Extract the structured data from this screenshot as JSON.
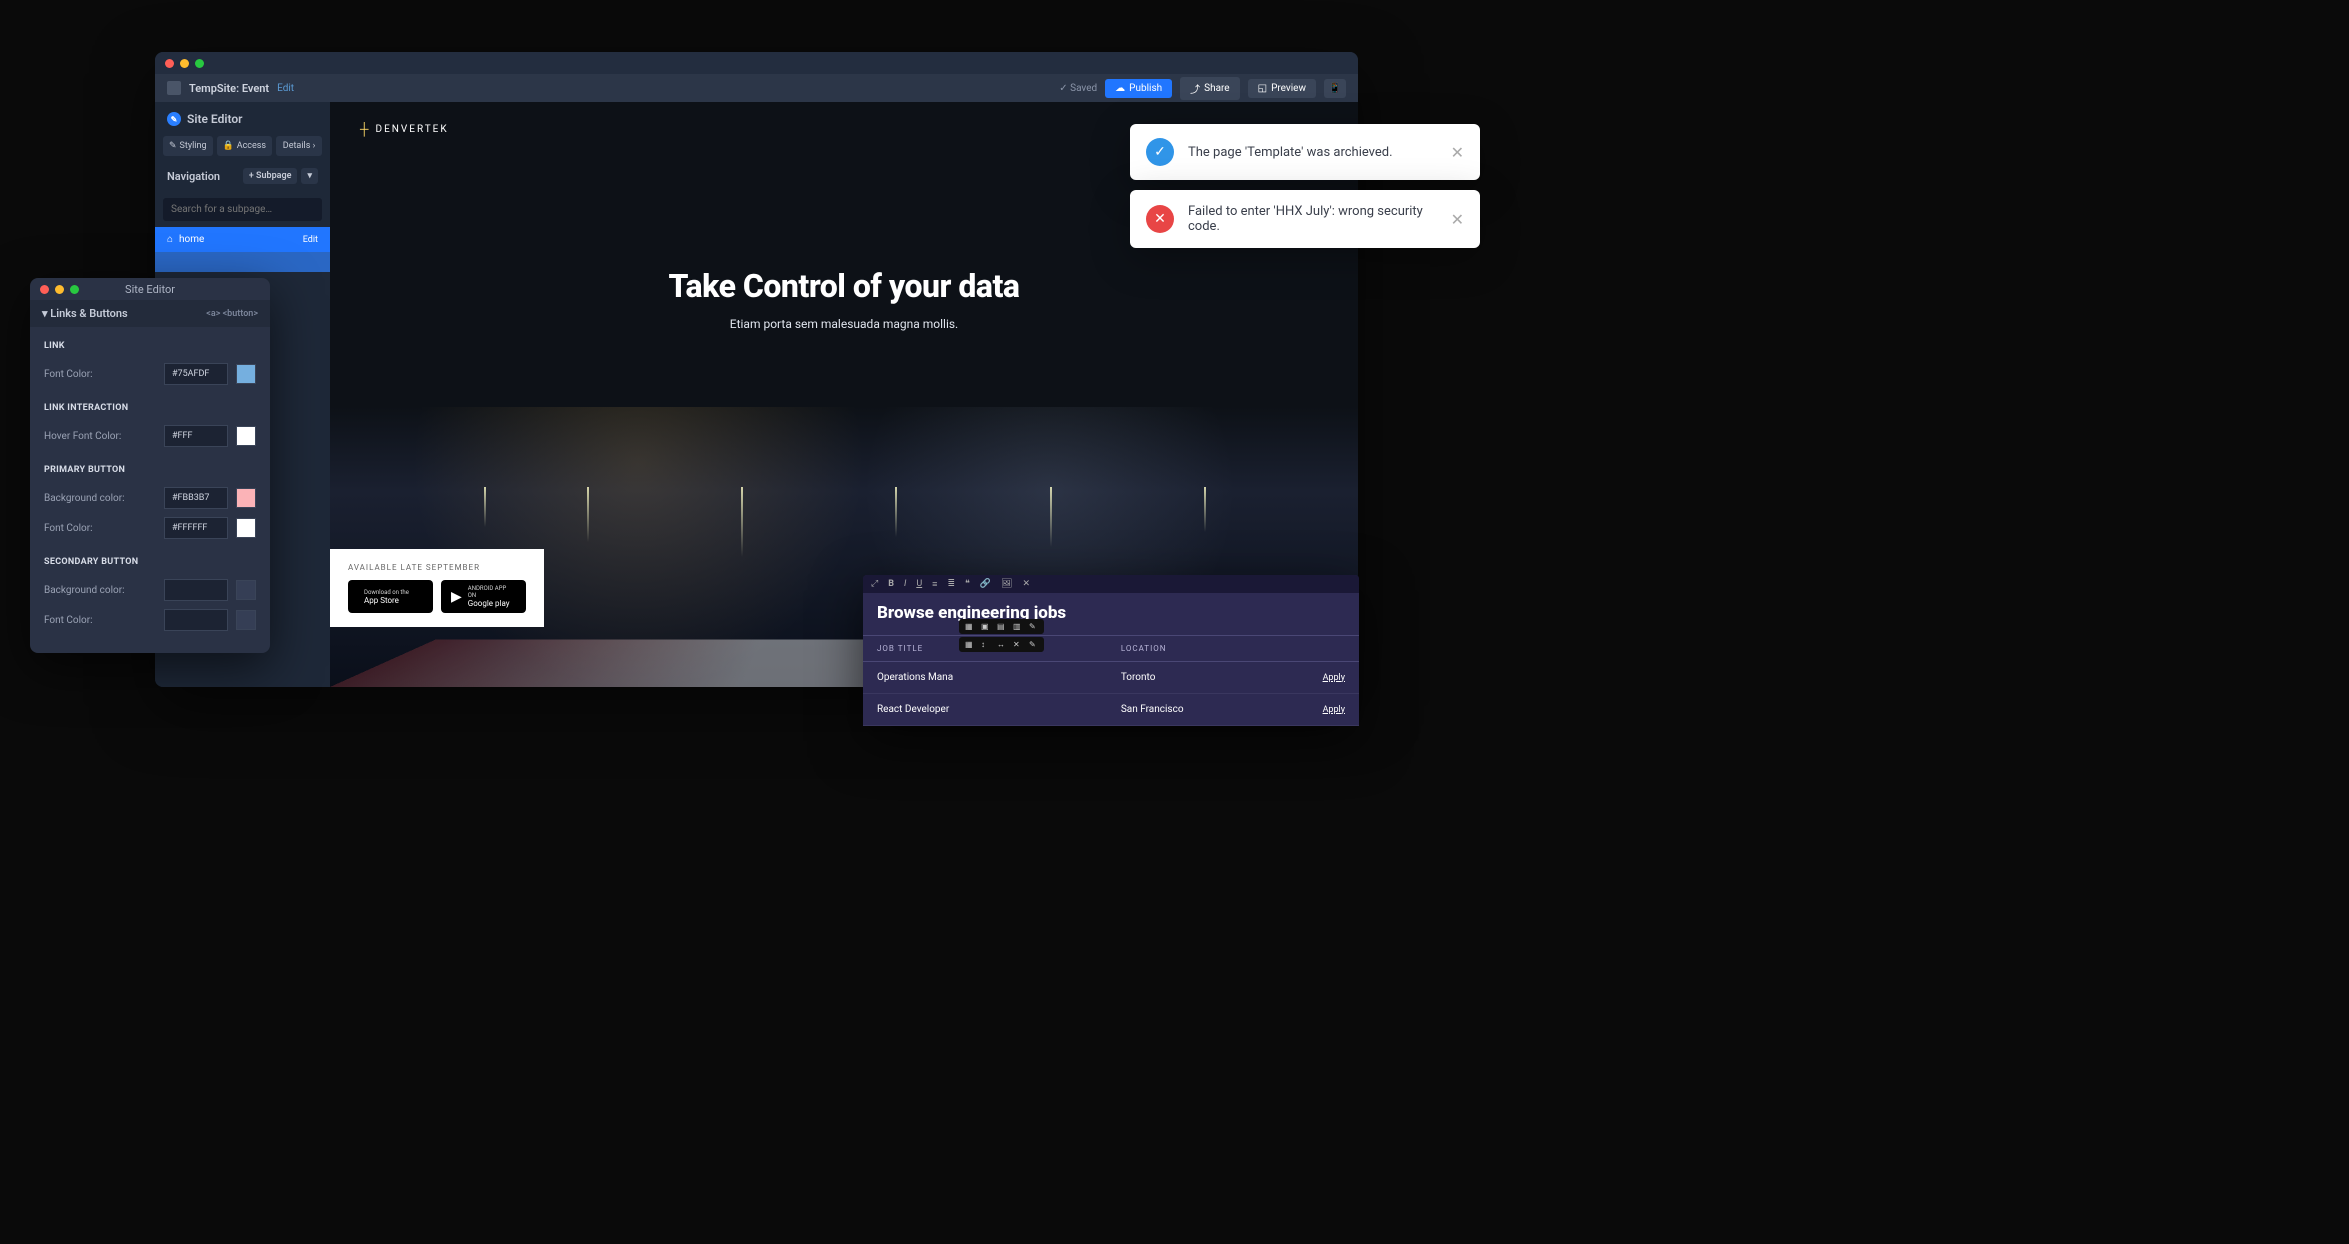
{
  "mainWindow": {
    "siteName": "TempSite: Event",
    "editLink": "Edit",
    "saved": "Saved",
    "publishBtn": "Publish",
    "shareBtn": "Share",
    "previewBtn": "Preview"
  },
  "sidebar": {
    "title": "Site Editor",
    "tabs": {
      "styling": "Styling",
      "access": "Access",
      "details": "Details ›"
    },
    "navigation": {
      "title": "Navigation",
      "addBtn": "+ Subpage",
      "searchPlaceholder": "Search for a subpage…",
      "page": {
        "name": "home",
        "editLabel": "Edit"
      }
    }
  },
  "canvas": {
    "brand": "DENVERTEK",
    "heroTitle": "Take Control of your data",
    "heroSub": "Etiam porta sem malesuada magna mollis.",
    "appBadges": {
      "label": "AVAILABLE LATE SEPTEMBER",
      "appStore": {
        "line1": "Download on the",
        "line2": "App Store"
      },
      "googlePlay": {
        "line1": "ANDROID APP ON",
        "line2": "Google play"
      }
    }
  },
  "stylePanel": {
    "windowTitle": "Site Editor",
    "sectionTitle": "Links & Buttons",
    "sectionTags": "<a> <button>",
    "groups": {
      "link": {
        "label": "LINK",
        "fontColor": {
          "label": "Font Color:",
          "value": "#75AFDF",
          "swatch": "#75AFDF"
        }
      },
      "linkInteraction": {
        "label": "LINK INTERACTION",
        "hoverFontColor": {
          "label": "Hover Font Color:",
          "value": "#FFF",
          "swatch": "#FFFFFF"
        }
      },
      "primaryButton": {
        "label": "PRIMARY BUTTON",
        "bgColor": {
          "label": "Background color:",
          "value": "#FBB3B7",
          "swatch": "#FBB3B7"
        },
        "fontColor": {
          "label": "Font Color:",
          "value": "#FFFFFF",
          "swatch": "#FFFFFF"
        }
      },
      "secondaryButton": {
        "label": "SECONDARY BUTTON",
        "bgColor": {
          "label": "Background color:",
          "value": "",
          "swatch": "#2a3245"
        },
        "fontColor": {
          "label": "Font Color:",
          "value": "",
          "swatch": "#2a3245"
        }
      }
    }
  },
  "jobsPanel": {
    "title": "Browse engineering  jobs",
    "columns": {
      "jobTitle": "JOB TITLE",
      "location": "LOCATION",
      "apply": "Apply"
    },
    "rows": [
      {
        "title": "Operations Mana",
        "location": "Toronto"
      },
      {
        "title": "React Developer",
        "location": "San Francisco"
      }
    ]
  },
  "toasts": {
    "success": "The page 'Template' was archieved.",
    "error": "Failed to enter 'HHX July': wrong security code."
  }
}
